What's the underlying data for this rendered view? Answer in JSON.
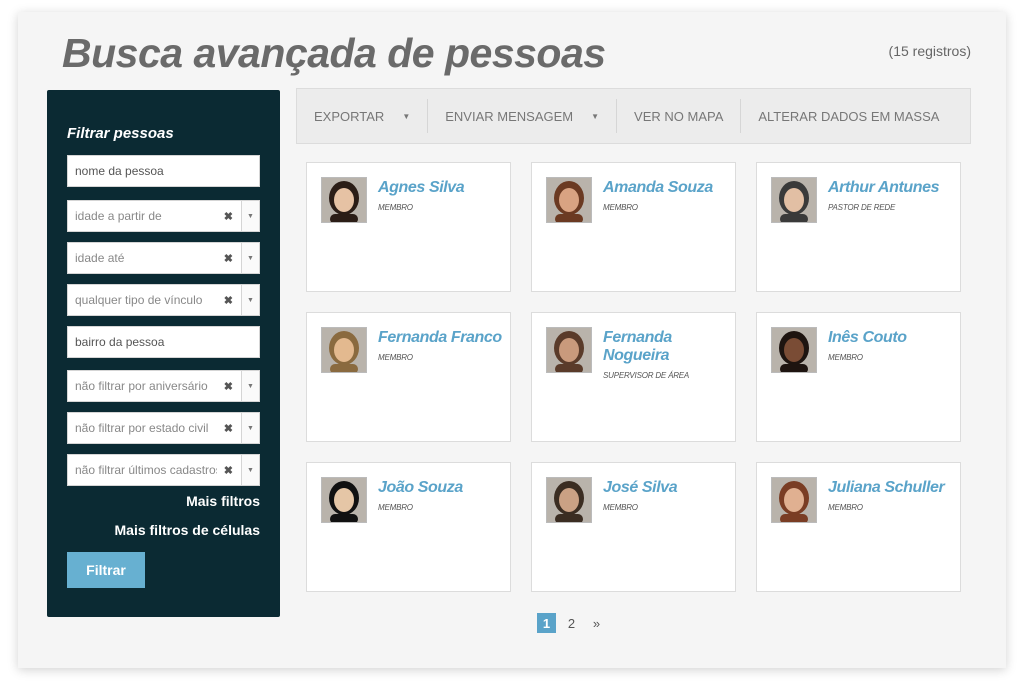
{
  "page": {
    "title": "Busca avançada de pessoas",
    "record_count": "(15 registros)"
  },
  "sidebar": {
    "title": "Filtrar pessoas",
    "fields": {
      "name_placeholder": "nome da pessoa",
      "age_from": "idade a partir de",
      "age_to": "idade até",
      "link_type": "qualquer tipo de vínculo",
      "neighborhood_placeholder": "bairro da pessoa",
      "birthday": "não filtrar por aniversário",
      "marital_status": "não filtrar por estado civil",
      "last_registrations": "não filtrar últimos cadastros"
    },
    "more_filters": "Mais filtros",
    "more_cell_filters": "Mais filtros de células",
    "filter_button": "Filtrar"
  },
  "toolbar": {
    "export": "EXPORTAR",
    "send_message": "ENVIAR MENSAGEM",
    "view_map": "VER NO MAPA",
    "bulk_edit": "ALTERAR DADOS EM MASSA"
  },
  "people": [
    {
      "name": "Agnes Silva",
      "role": "MEMBRO",
      "skin": "#e6c2a4",
      "hair": "#2b1d16"
    },
    {
      "name": "Amanda Souza",
      "role": "MEMBRO",
      "skin": "#d9a382",
      "hair": "#6b3a22"
    },
    {
      "name": "Arthur Antunes",
      "role": "PASTOR DE REDE",
      "skin": "#e2bfa4",
      "hair": "#3a3a3a"
    },
    {
      "name": "Fernanda Franco",
      "role": "MEMBRO",
      "skin": "#e3b98f",
      "hair": "#8a6a3f"
    },
    {
      "name": "Fernanda Nogueira",
      "role": "SUPERVISOR DE ÁREA",
      "skin": "#c99a7c",
      "hair": "#5a3b2a"
    },
    {
      "name": "Inês Couto",
      "role": "MEMBRO",
      "skin": "#7a4c35",
      "hair": "#1e1410"
    },
    {
      "name": "João Souza",
      "role": "MEMBRO",
      "skin": "#e5c6a6",
      "hair": "#111111"
    },
    {
      "name": "José Silva",
      "role": "MEMBRO",
      "skin": "#caa184",
      "hair": "#3b2d22"
    },
    {
      "name": "Juliana Schuller",
      "role": "MEMBRO",
      "skin": "#e0b091",
      "hair": "#7a3d24"
    }
  ],
  "pagination": {
    "page1": "1",
    "page2": "2",
    "next": "»"
  }
}
